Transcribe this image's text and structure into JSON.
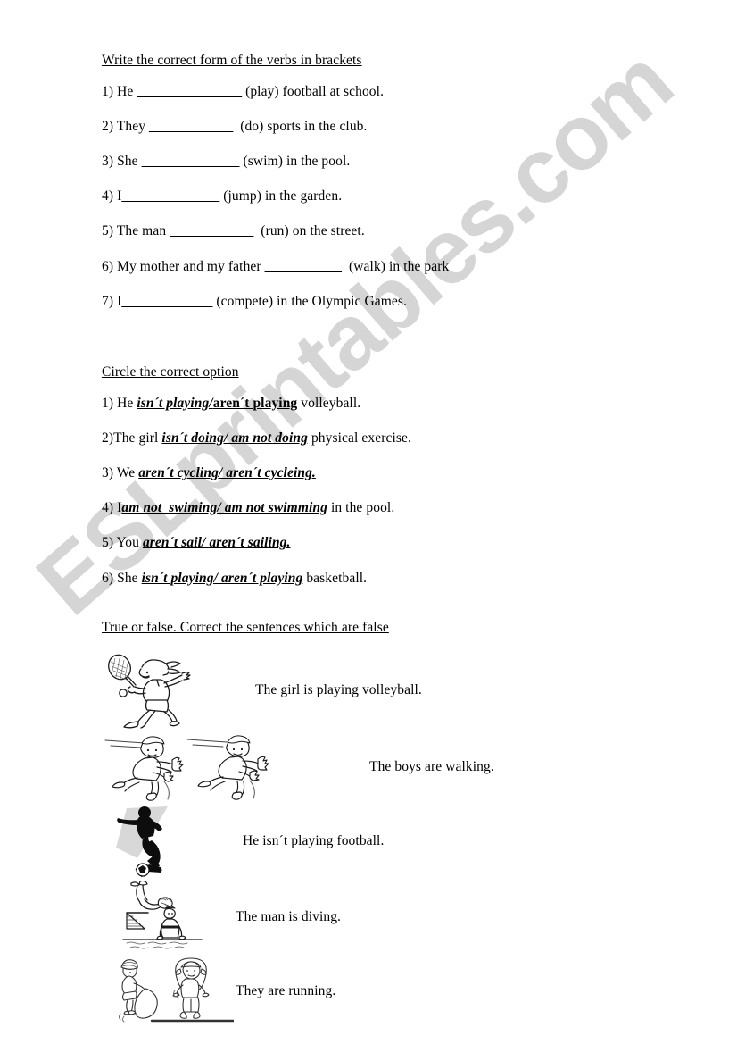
{
  "watermark": {
    "text": "ESLprintables.com",
    "color": "#d5d5d5"
  },
  "section1": {
    "heading": "Write the correct form of the verbs in brackets",
    "items": [
      {
        "num": "1) ",
        "subject": "He ",
        "blank": "_______________",
        "tail": " (play) football at school."
      },
      {
        "num": "2) ",
        "subject": "They ",
        "blank": "____________",
        "tail": "  (do) sports in the club."
      },
      {
        "num": "3) ",
        "subject": "She ",
        "blank": "______________",
        "tail": " (swim) in the pool."
      },
      {
        "num": "4) ",
        "subject": "I",
        "blank": "______________",
        "tail": " (jump) in the garden."
      },
      {
        "num": "5) ",
        "subject": "The man ",
        "blank": "____________",
        "tail": "  (run) on the street."
      },
      {
        "num": "6) ",
        "subject": "My mother and my father ",
        "blank": "___________",
        "tail": "  (walk) in the park"
      },
      {
        "num": "7) ",
        "subject": "I",
        "blank": "_____________",
        "tail": " (compete) in the Olympic Games."
      }
    ]
  },
  "section2": {
    "heading": "Circle the correct option",
    "items": [
      {
        "num": "1) ",
        "pre": "He ",
        "opt_italic": "isn´t playing/",
        "opt_bold": "aren´t playing",
        "post": " volleyball."
      },
      {
        "num": "2)",
        "pre": "The girl ",
        "opt_italic": "isn´t doing/ am not doing",
        "opt_bold": "",
        "post": " physical exercise."
      },
      {
        "num": "3) ",
        "pre": "We ",
        "opt_italic": "aren´t cycling/ aren´t cycleing.",
        "opt_bold": "",
        "post": ""
      },
      {
        "num": "4) ",
        "pre": "I",
        "opt_italic": "am not  swiming/ am not swimming",
        "opt_bold": "",
        "post": " in the pool."
      },
      {
        "num": "5) ",
        "pre": "You ",
        "opt_italic": "aren´t sail/ aren´t sailing.",
        "opt_bold": "",
        "post": ""
      },
      {
        "num": "6) ",
        "pre": "She ",
        "opt_italic": "isn´t playing/ aren´t playing",
        "opt_bold": "",
        "post": " basketball."
      }
    ]
  },
  "section3": {
    "heading": "True or false. Correct the sentences which are false",
    "items": [
      {
        "picture": "girl-playing-tennis",
        "sentence": "The girl is playing volleyball."
      },
      {
        "picture": "two-boys-running",
        "sentence": "The boys are walking."
      },
      {
        "picture": "footballer-silhouette-kicking-ball",
        "sentence": "He isn´t playing football."
      },
      {
        "picture": "diver-on-diving-board-at-pool",
        "sentence": "The man is diving."
      },
      {
        "picture": "two-children-skipping-rope",
        "sentence": "They are running."
      }
    ]
  }
}
